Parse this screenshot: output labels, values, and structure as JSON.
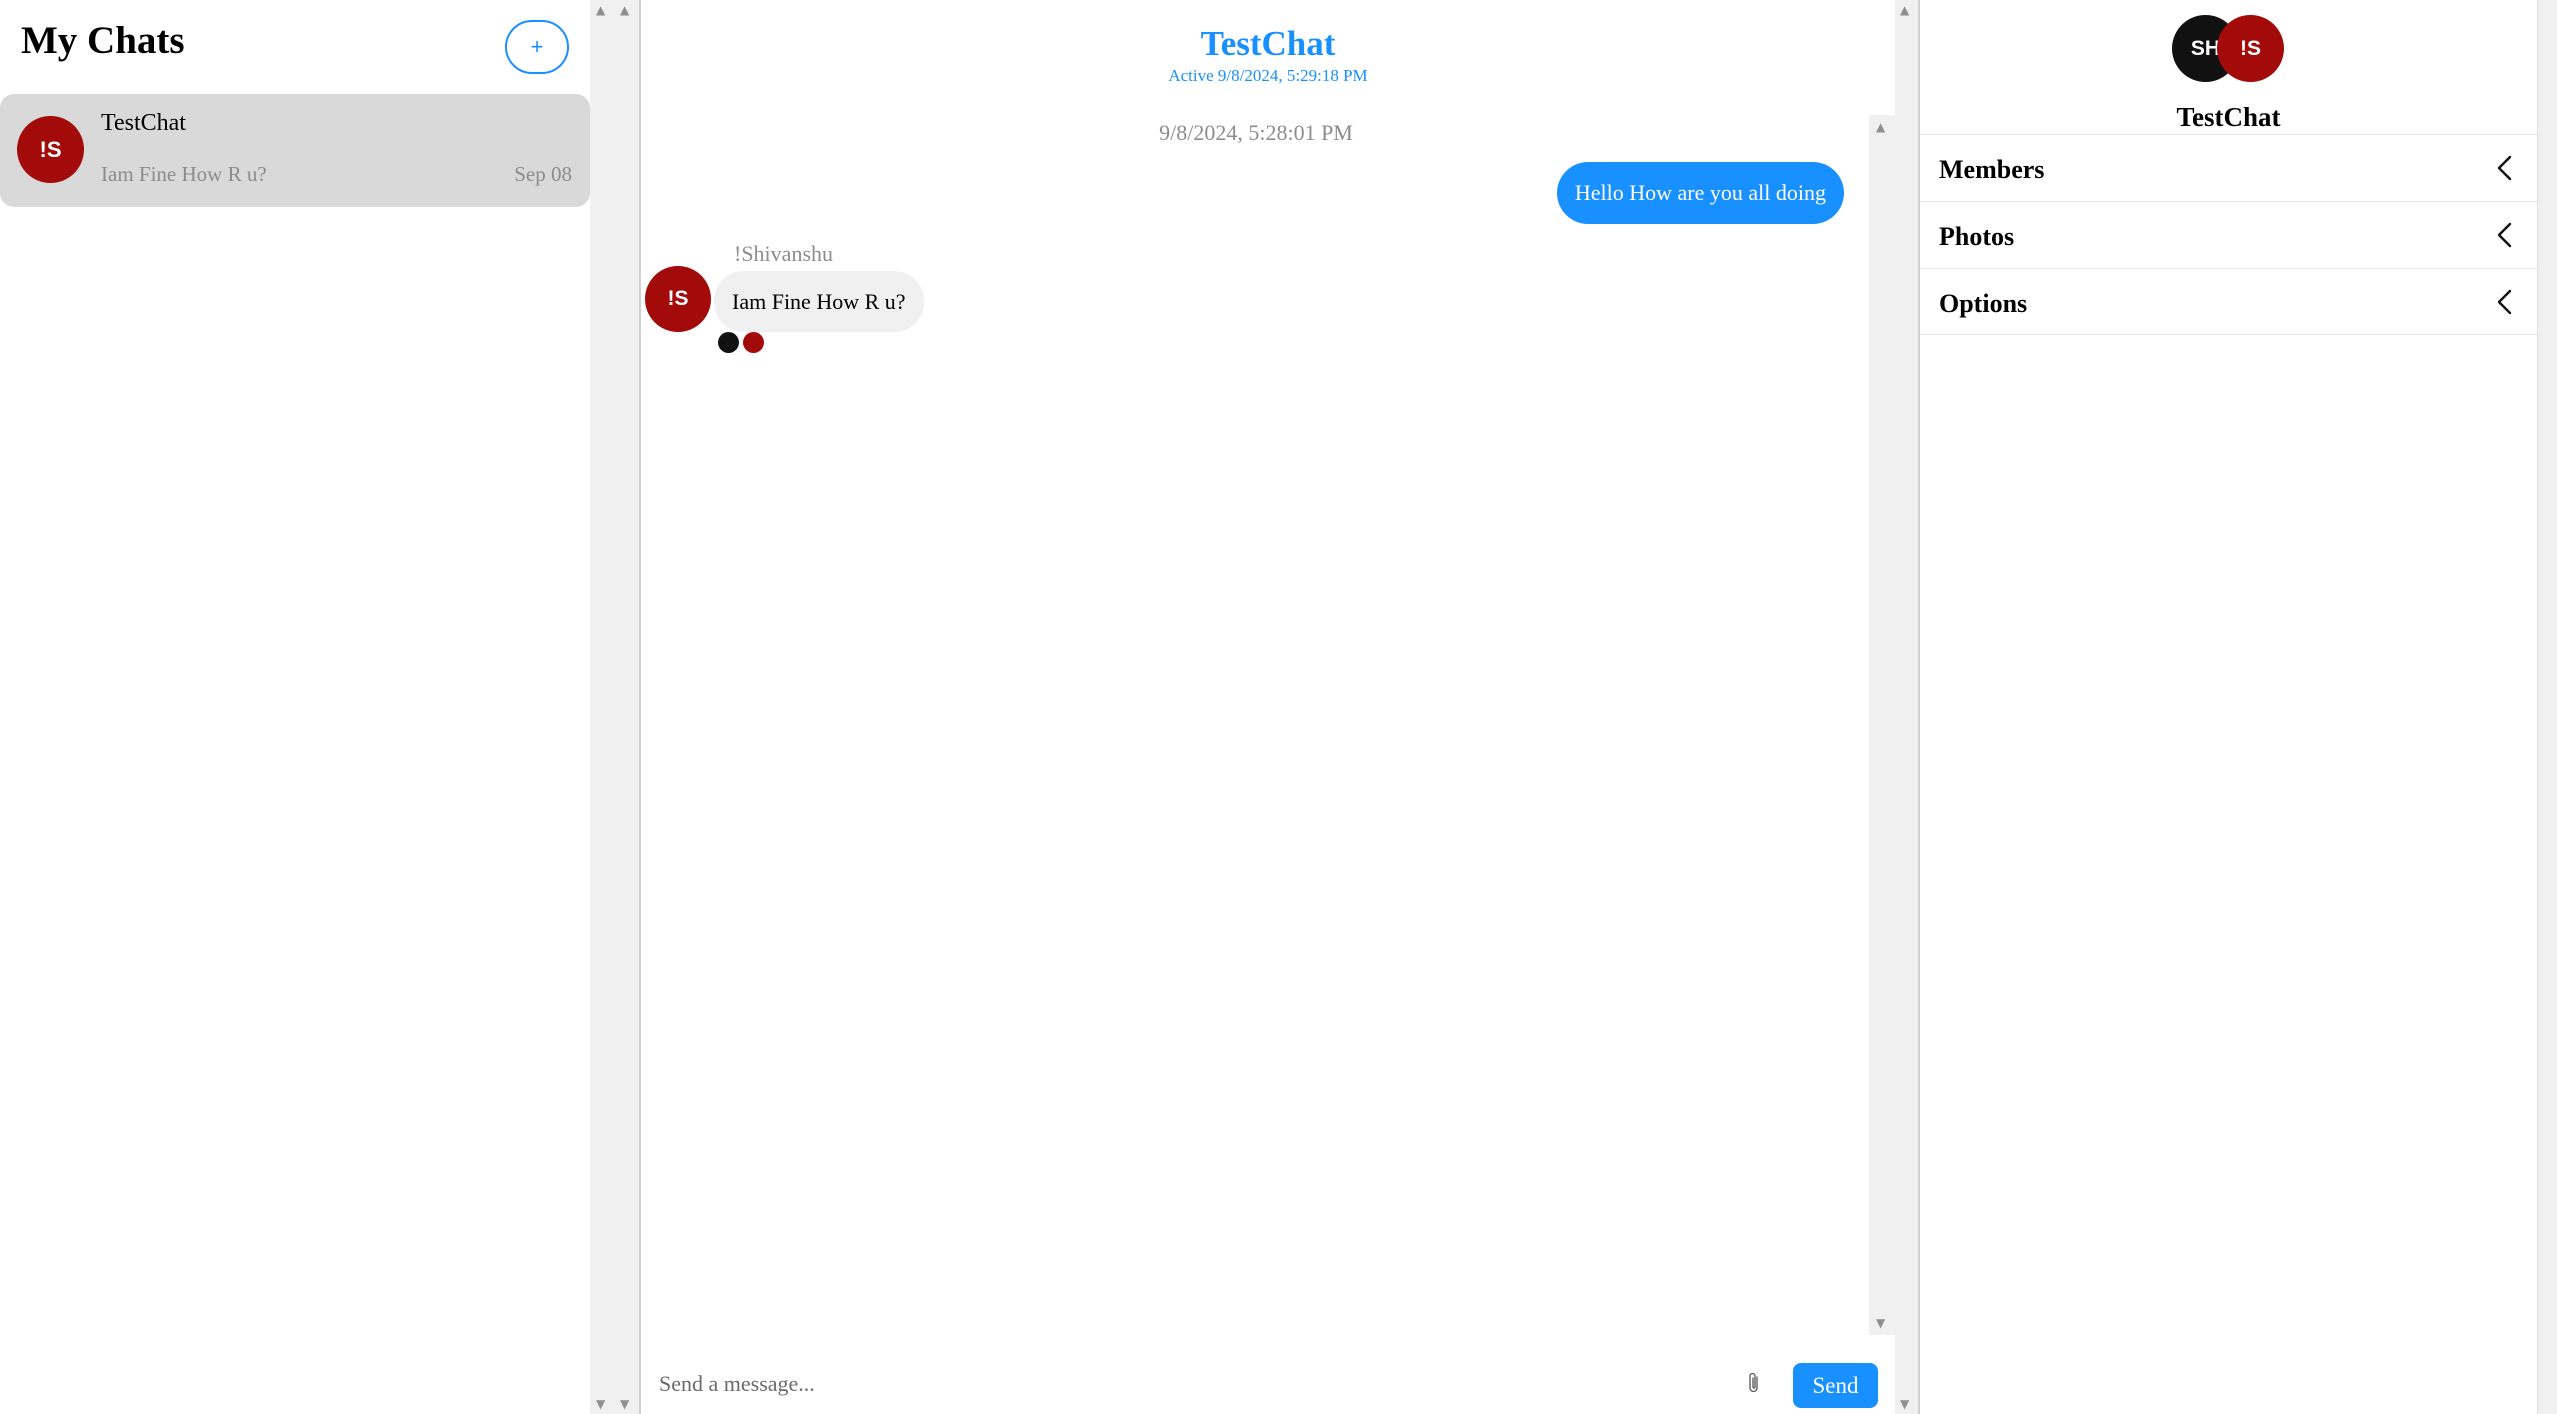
{
  "colors": {
    "accent": "#1890ff",
    "avatar_red": "#a30a0a",
    "avatar_black": "#111111",
    "selected_item_bg": "#d9d9d9",
    "incoming_bubble_bg": "#f0f0f0",
    "muted_text": "#8c8c8c"
  },
  "sidebar": {
    "title": "My Chats",
    "new_chat_label": "+",
    "chats": [
      {
        "avatar_initials": "!S",
        "name": "TestChat",
        "last_message": "Iam Fine How R u?",
        "date": "Sep 08",
        "selected": true
      }
    ]
  },
  "conversation": {
    "title": "TestChat",
    "status": "Active 9/8/2024, 5:29:18 PM",
    "date_divider": "9/8/2024, 5:28:01 PM",
    "messages": [
      {
        "direction": "outgoing",
        "text": "Hello How are you all doing"
      },
      {
        "direction": "incoming",
        "sender": "!Shivanshu",
        "avatar_initials": "!S",
        "text": "Iam Fine How R u?"
      }
    ],
    "read_receipts": [
      "black",
      "red"
    ],
    "composer": {
      "placeholder": "Send a message...",
      "attach_icon": "paperclip-icon",
      "send_label": "Send"
    }
  },
  "details": {
    "avatars": [
      {
        "initials": "SH"
      },
      {
        "initials": "!S"
      }
    ],
    "name": "TestChat",
    "sections": [
      {
        "label": "Members",
        "icon": "chevron-left-icon"
      },
      {
        "label": "Photos",
        "icon": "chevron-left-icon"
      },
      {
        "label": "Options",
        "icon": "chevron-left-icon"
      }
    ]
  },
  "scrollbars": {
    "up_arrow": "▲",
    "down_arrow": "▼"
  }
}
